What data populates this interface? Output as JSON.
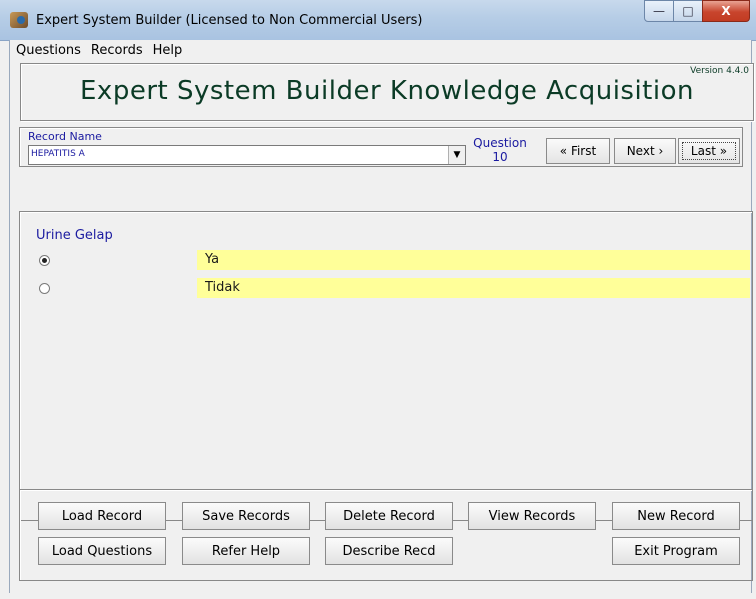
{
  "window": {
    "title": "Expert System Builder (Licensed to Non Commercial Users)",
    "controls": {
      "minimize": "—",
      "maximize": "□",
      "close": "X"
    }
  },
  "menu": [
    "Questions",
    "Records",
    "Help"
  ],
  "banner": {
    "title": "Expert System Builder Knowledge Acquisition",
    "version": "Version 4.4.0"
  },
  "record": {
    "label": "Record Name",
    "value": "HEPATITIS A",
    "question_label": "Question",
    "question_number": "10",
    "first_label": "« First",
    "next_label": "Next ›",
    "last_label": "Last »"
  },
  "question": {
    "text": "Urine Gelap",
    "options": [
      {
        "label": "Ya",
        "selected": true
      },
      {
        "label": "Tidak",
        "selected": false
      }
    ]
  },
  "buttons": {
    "load_record": "Load Record",
    "save_records": "Save Records",
    "delete_record": "Delete Record",
    "view_records": "View Records",
    "new_record": "New Record",
    "load_questions": "Load Questions",
    "refer_help": "Refer Help",
    "describe_recd": "Describe Recd",
    "exit_program": "Exit Program"
  },
  "colors": {
    "field_highlight": "#ffff99",
    "label_blue": "#1a1aa0",
    "title_green": "#0b3b26"
  }
}
